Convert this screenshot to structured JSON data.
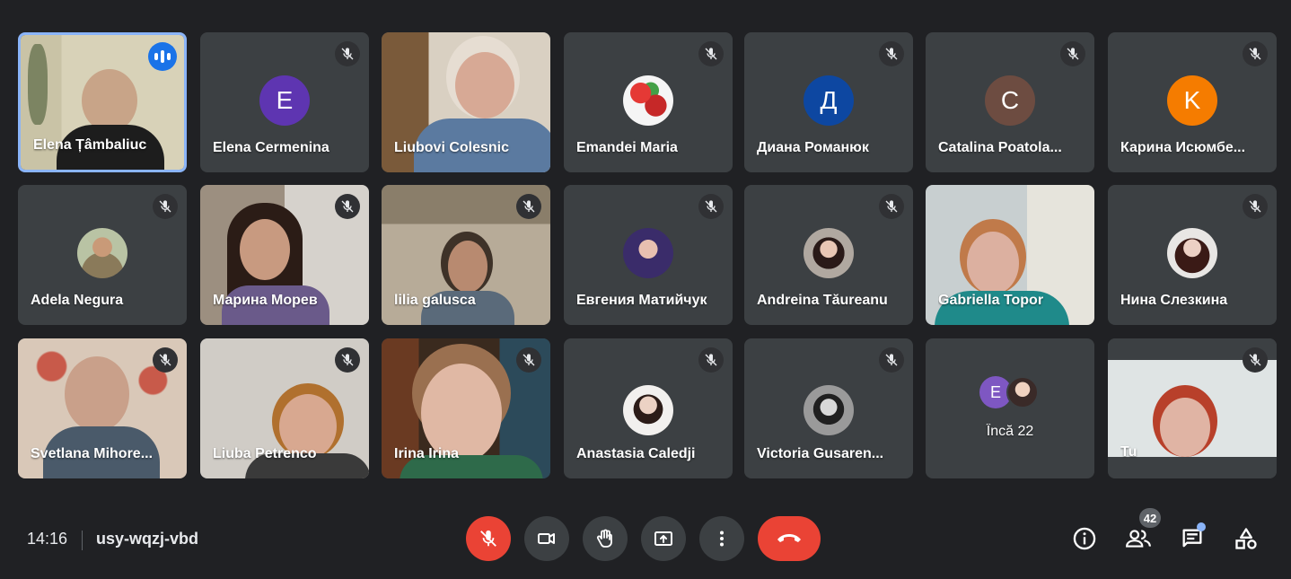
{
  "participants": [
    {
      "name": "Elena Țâmbaliuc",
      "speaking": true
    },
    {
      "name": "Elena Cermenina",
      "initial": "E",
      "avatar_color": "#5e35b1",
      "muted": true
    },
    {
      "name": "Liubovi Colesnic"
    },
    {
      "name": "Emandei Maria",
      "muted": true
    },
    {
      "name": "Диана Романюк",
      "initial": "Д",
      "avatar_color": "#0d47a1",
      "muted": true
    },
    {
      "name": "Catalina Poatola...",
      "initial": "C",
      "avatar_color": "#6d4c41",
      "muted": true
    },
    {
      "name": "Карина Исюмбе...",
      "initial": "K",
      "avatar_color": "#f57c00",
      "muted": true
    },
    {
      "name": "Adela Negura",
      "muted": true
    },
    {
      "name": "Марина Морев",
      "muted": true
    },
    {
      "name": "lilia galusca",
      "muted": true
    },
    {
      "name": "Евгения Матийчук",
      "muted": true
    },
    {
      "name": "Andreina Tăureanu",
      "muted": true
    },
    {
      "name": "Gabriella Topor"
    },
    {
      "name": "Нина Слезкина",
      "muted": true
    },
    {
      "name": "Svetlana Mihore...",
      "muted": true
    },
    {
      "name": "Liuba Petrenco",
      "muted": true
    },
    {
      "name": "Irina Irina",
      "muted": true
    },
    {
      "name": "Anastasia Caledji",
      "muted": true
    },
    {
      "name": "Victoria Gusaren...",
      "muted": true
    },
    {
      "name": "Încă 22",
      "others_tile": true,
      "initial": "E"
    },
    {
      "name": "Tu",
      "self": true,
      "muted": true
    }
  ],
  "meeting": {
    "time": "14:16",
    "code": "usy-wqzj-vbd"
  },
  "people_count": "42",
  "controls": [
    "mic-off",
    "camera",
    "raise-hand",
    "present",
    "more",
    "leave"
  ],
  "colors": {
    "background": "#202124",
    "tile": "#3c4043",
    "red": "#ea4335",
    "accent": "#8ab4f8"
  }
}
